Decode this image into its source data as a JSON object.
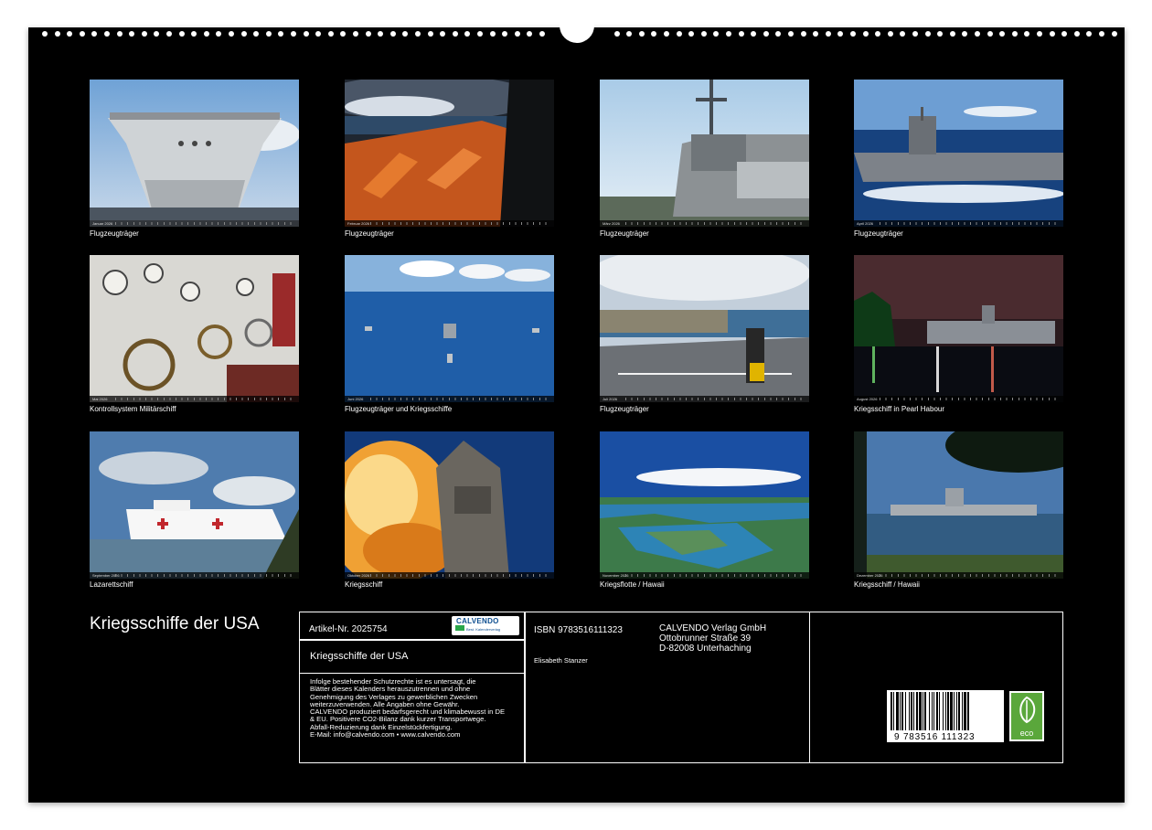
{
  "calendar": {
    "title": "Kriegsschiffe der USA",
    "months": [
      {
        "month": "Januar 2026",
        "caption": "Flugzeugträger"
      },
      {
        "month": "Februar 2026",
        "caption": "Flugzeugträger"
      },
      {
        "month": "März 2026",
        "caption": "Flugzeugträger"
      },
      {
        "month": "April 2026",
        "caption": "Flugzeugträger"
      },
      {
        "month": "Mai 2026",
        "caption": "Kontrollsystem Militärschiff"
      },
      {
        "month": "Juni 2026",
        "caption": "Flugzeugträger und Kriegsschiffe"
      },
      {
        "month": "Juli 2026",
        "caption": "Flugzeugträger"
      },
      {
        "month": "August 2026",
        "caption": "Kriegsschiff in Pearl Habour"
      },
      {
        "month": "September 2026",
        "caption": "Lazarettschiff"
      },
      {
        "month": "Oktober 2026",
        "caption": "Kriegsschiff"
      },
      {
        "month": "November 2026",
        "caption": "Kriegsflotte / Hawaii"
      },
      {
        "month": "Dezember 2026",
        "caption": "Kriegsschiff / Hawaii"
      }
    ]
  },
  "info": {
    "article": "Artikel-Nr. 2025754",
    "logo_word": "CALVENDO",
    "logo_sub": "Best. Kalenderverlag",
    "product_title": "Kriegsschiffe der USA",
    "legal": [
      "Infolge bestehender Schutzrechte ist es untersagt, die",
      "Blätter dieses Kalenders herauszutrennen und ohne",
      "Genehmigung des Verlages zu gewerblichen Zwecken",
      "weiterzuverwenden. Alle Angaben ohne Gewähr.",
      "CALVENDO produziert bedarfsgerecht und klimabewusst in DE",
      "& EU. Positivere CO2-Bilanz dank kurzer Transportwege.",
      "Abfall-Reduzierung dank Einzelstückfertigung.",
      "E-Mail: info@calvendo.com • www.calvendo.com"
    ],
    "isbn": "ISBN 9783516111323",
    "author": "Elisabeth Stanzer",
    "publisher": [
      "CALVENDO Verlag GmbH",
      "Ottobrunner Straße 39",
      "D-82008 Unterhaching"
    ],
    "barcode_number": "9 783516 111323",
    "eco_label": "eco"
  },
  "colors": {
    "sheet": "#000000",
    "eco_green": "#5aa73b",
    "logo_blue": "#0c4d8f"
  }
}
